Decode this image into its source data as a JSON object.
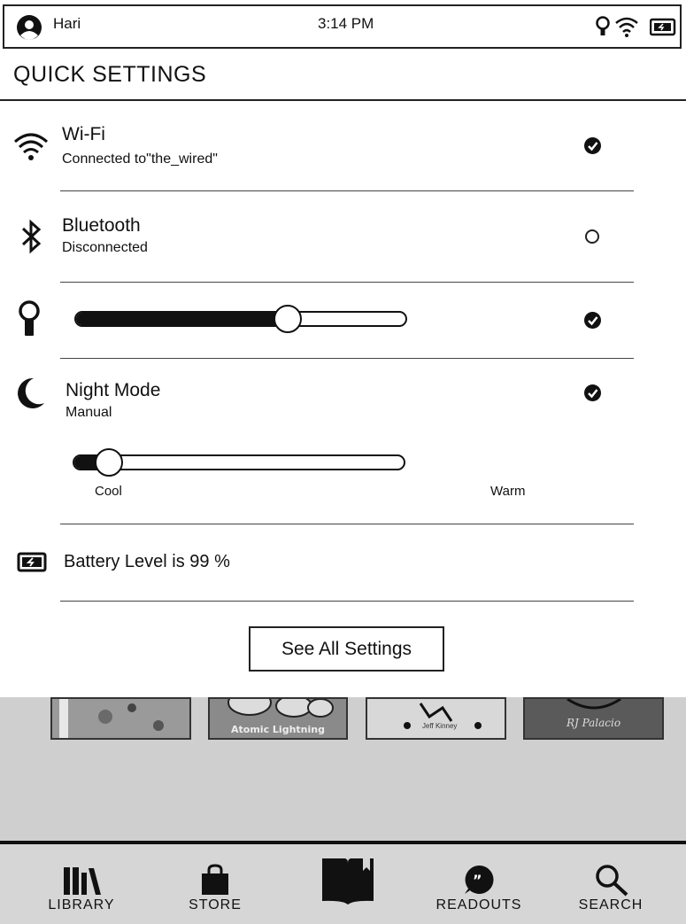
{
  "status_bar": {
    "user": "Hari",
    "time": "3:14 PM"
  },
  "quick_settings": {
    "title": "QUICK SETTINGS",
    "wifi": {
      "title": "Wi-Fi",
      "subtitle": "Connected to\"the_wired\"",
      "enabled": true
    },
    "bluetooth": {
      "title": "Bluetooth",
      "subtitle": "Disconnected",
      "enabled": false
    },
    "brightness": {
      "level": 0.64,
      "enabled": true
    },
    "night_mode": {
      "title": "Night Mode",
      "subtitle": "Manual",
      "enabled": true,
      "warmth_level": 0.11,
      "left_label": "Cool",
      "right_label": "Warm"
    },
    "battery": {
      "text": "Battery Level is 99 %"
    },
    "see_all_label": "See All Settings"
  },
  "library_books": [
    {
      "title": ""
    },
    {
      "title": "Atomic Lightning"
    },
    {
      "title": "Jeff Kinney"
    },
    {
      "title": "RJ Palacio"
    }
  ],
  "nav": {
    "items": [
      {
        "label": "LIBRARY",
        "icon": "library-icon"
      },
      {
        "label": "STORE",
        "icon": "shopping-bag-icon"
      },
      {
        "label": "",
        "icon": "open-book-icon"
      },
      {
        "label": "READOUTS",
        "icon": "quote-bubble-icon"
      },
      {
        "label": "SEARCH",
        "icon": "search-icon"
      }
    ]
  },
  "colors": {
    "ink": "#111111",
    "paper": "#ffffff",
    "library_gray": "#cfcfcf",
    "nav_gray": "#d6d6d6"
  }
}
